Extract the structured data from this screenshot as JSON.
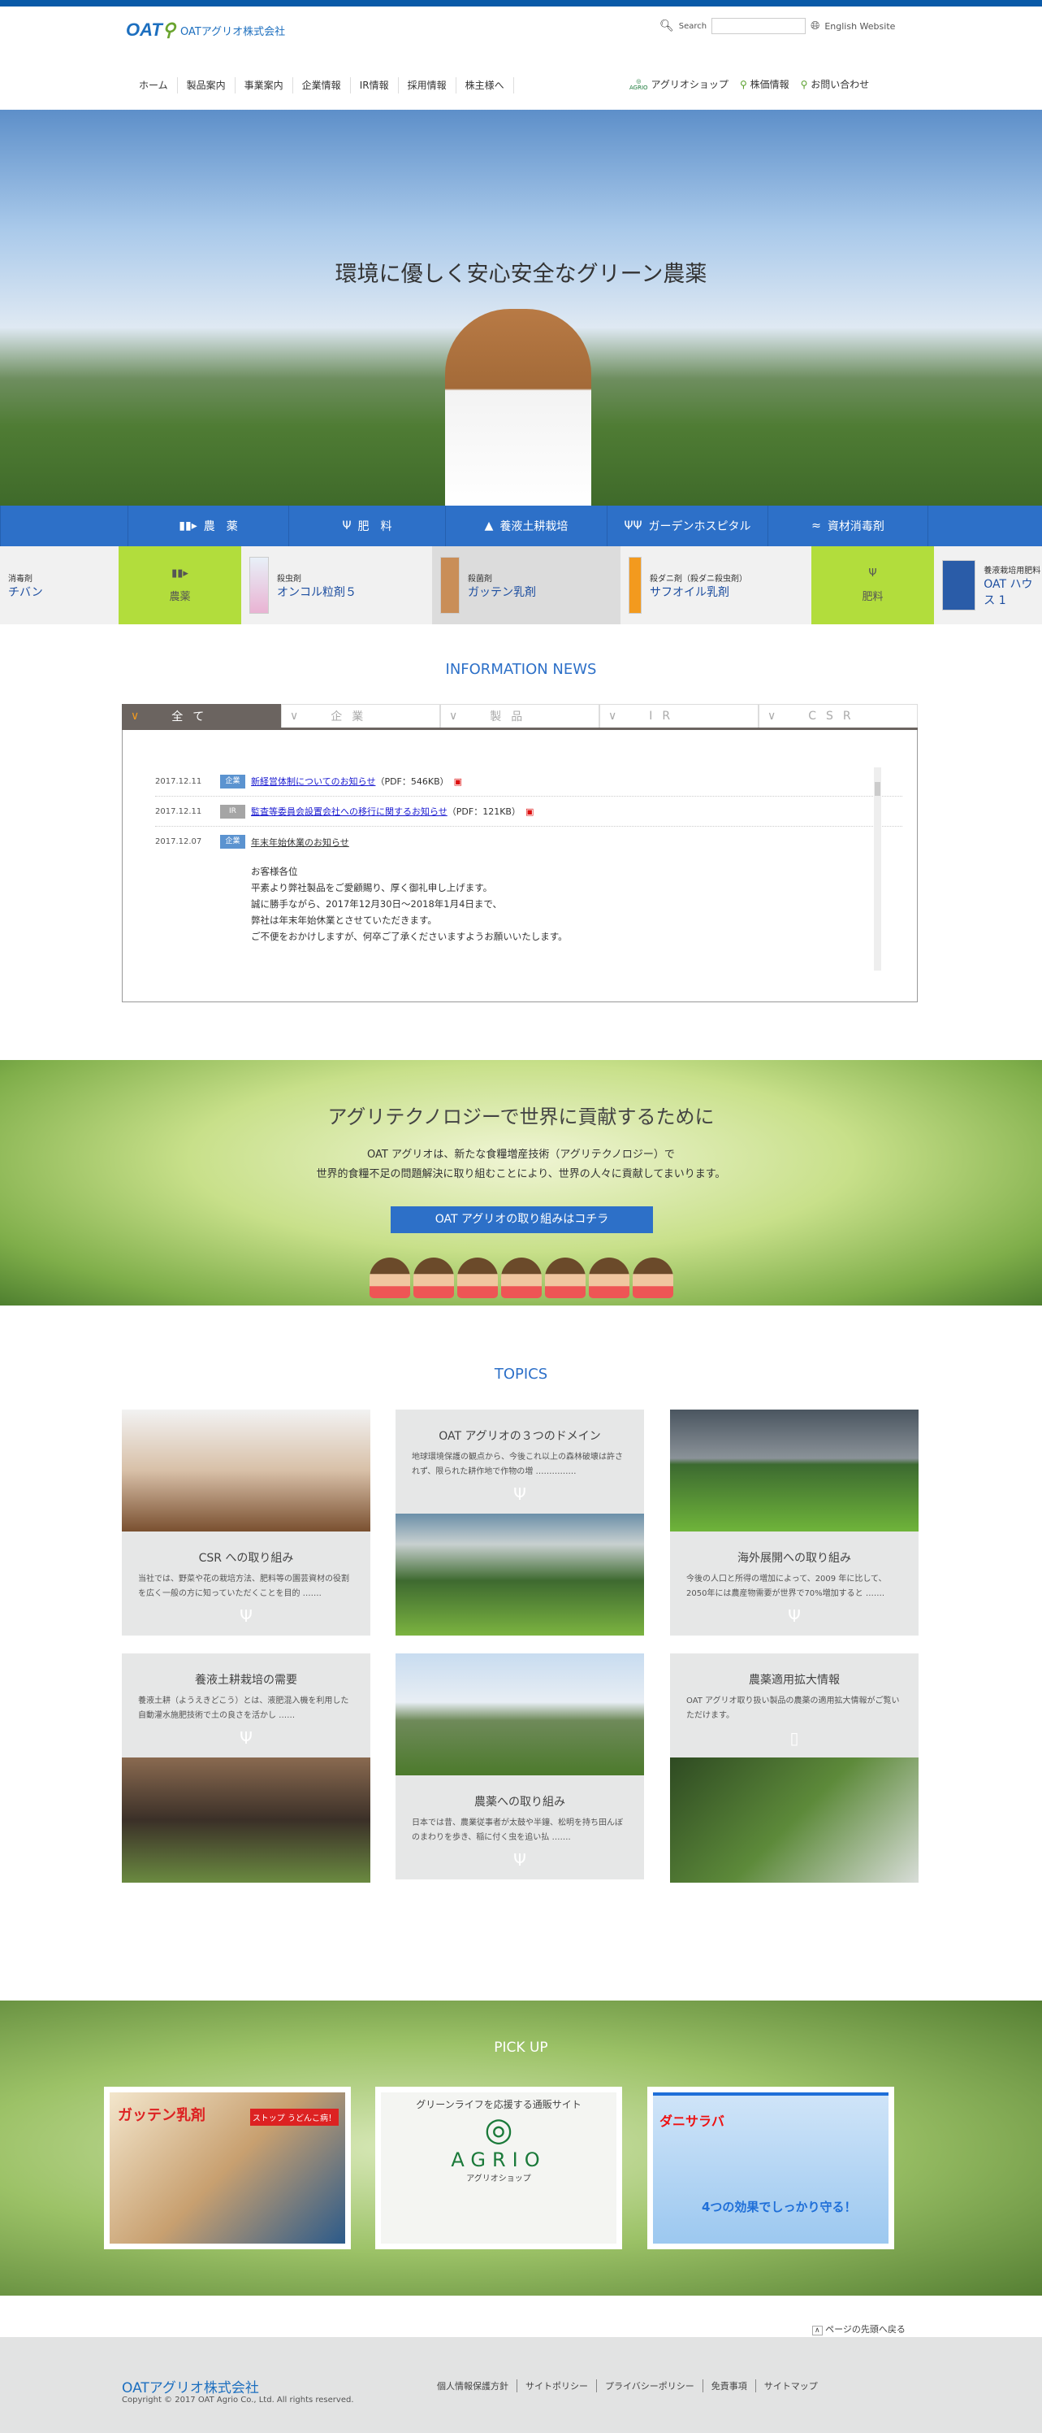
{
  "header": {
    "logo_mark": "OAT",
    "company": "OATアグリオ株式会社",
    "search_label": "Search",
    "search_value": "",
    "english": "English Website"
  },
  "nav": [
    "ホーム",
    "製品案内",
    "事業案内",
    "企業情報",
    "IR情報",
    "採用情報",
    "株主様へ"
  ],
  "nav_right": {
    "agrio_logo": "AGRIO",
    "shop": "アグリオショップ",
    "stock": "株価情報",
    "contact": "お問い合わせ"
  },
  "hero": {
    "title": "環境に優しく安心安全なグリーン農薬"
  },
  "categories": [
    "農　薬",
    "肥　料",
    "養液土耕栽培",
    "ガーデンホスピタル",
    "資材消毒剤"
  ],
  "products": [
    {
      "type": "消毒剤",
      "name": "チバン"
    },
    {
      "category": "農薬"
    },
    {
      "type": "殺虫剤",
      "name": "オンコル粒剤５"
    },
    {
      "type": "殺菌剤",
      "name": "ガッテン乳剤"
    },
    {
      "type": "殺ダニ剤（殺ダニ殺虫剤）",
      "name": "サフオイル乳剤"
    },
    {
      "category": "肥料"
    },
    {
      "type": "養液栽培用肥料",
      "name": "OAT ハウス 1"
    }
  ],
  "news": {
    "title": "INFORMATION NEWS",
    "tabs": [
      "全て",
      "企業",
      "製品",
      "IR",
      "CSR"
    ],
    "active_tab": 0,
    "items": [
      {
        "date": "2017.12.11",
        "badge": "企業",
        "badge_color": "#5b93d0",
        "title": "新経営体制についてのお知らせ",
        "size": "（PDF：546KB）"
      },
      {
        "date": "2017.12.11",
        "badge": "IR",
        "badge_color": "#a5a5a5",
        "title": "監査等委員会設置会社への移行に関するお知らせ",
        "size": "（PDF：121KB）"
      },
      {
        "date": "2017.12.07",
        "badge": "企業",
        "badge_color": "#5b93d0",
        "title": "年末年始休業のお知らせ",
        "size": ""
      }
    ],
    "body": [
      "お客様各位",
      "平素より弊社製品をご愛顧賜り、厚く御礼申し上げます。",
      "誠に勝手ながら、2017年12月30日～2018年1月4日まで、",
      "弊社は年末年始休業とさせていただきます。",
      "ご不便をおかけしますが、何卒ご了承くださいますようお願いいたします。"
    ]
  },
  "banner": {
    "title": "アグリテクノロジーで世界に貢献するために",
    "line1": "OAT アグリオは、新たな食糧増産技術（アグリテクノロジー）で",
    "line2": "世界的食糧不足の問題解決に取り組むことにより、世界の人々に貢献してまいります。",
    "button": "OAT アグリオの取り組みはコチラ"
  },
  "topics": {
    "title": "TOPICS",
    "cards": [
      {
        "title": "CSR への取り組み",
        "text": "当社では、野菜や花の栽培方法、肥料等の園芸資材の役割を広く一般の方に知っていただくことを目的 ……."
      },
      {
        "title": "OAT アグリオの３つのドメイン",
        "text": "地球環境保護の観点から、今後これ以上の森林破壊は許されず、限られた耕作地で作物の増 ……………"
      },
      {
        "title": "海外展開への取り組み",
        "text": "今後の人口と所得の増加によって、2009 年に比して、2050年には農産物需要が世界で70%増加すると ……."
      },
      {
        "title": "養液土耕栽培の需要",
        "text": "養液土耕（ようえきどこう）とは、液肥混入機を利用した自動灌水施肥技術で土の良さを活かし ……"
      },
      {
        "title": "農薬への取り組み",
        "text": "日本では昔、農業従事者が太鼓や半鐘、松明を持ち田んぼのまわりを歩き、稲に付く虫を追い払 ……."
      },
      {
        "title": "農薬適用拡大情報",
        "text": "OAT アグリオ取り扱い製品の農薬の適用拡大情報がご覧いただけます。"
      }
    ]
  },
  "pickup": {
    "title": "PICK UP",
    "cards": [
      {
        "headline": "ガッテン乳剤",
        "tag": "ストップ うどんこ病！"
      },
      {
        "headline": "グリーンライフを応援する通販サイト",
        "brand": "AGRIO",
        "sub": "アグリオショップ"
      },
      {
        "headline": "ダニサラバ",
        "tag": "4つの効果でしっかり守る！"
      }
    ]
  },
  "page_top": "ページの先頭へ戻る",
  "footer": {
    "company": "OATアグリオ株式会社",
    "copyright": "Copyright © 2017 OAT Agrio Co., Ltd. All rights reserved.",
    "links": [
      "個人情報保護方針",
      "サイトポリシー",
      "プライバシーポリシー",
      "免責事項",
      "サイトマップ"
    ]
  },
  "colors": {
    "brand_blue": "#2d70c8",
    "top_bar": "#0a5aa8",
    "lime": "#b2dd3c",
    "tab_active": "#6b6460",
    "footer_bg": "#e2e3e3"
  }
}
